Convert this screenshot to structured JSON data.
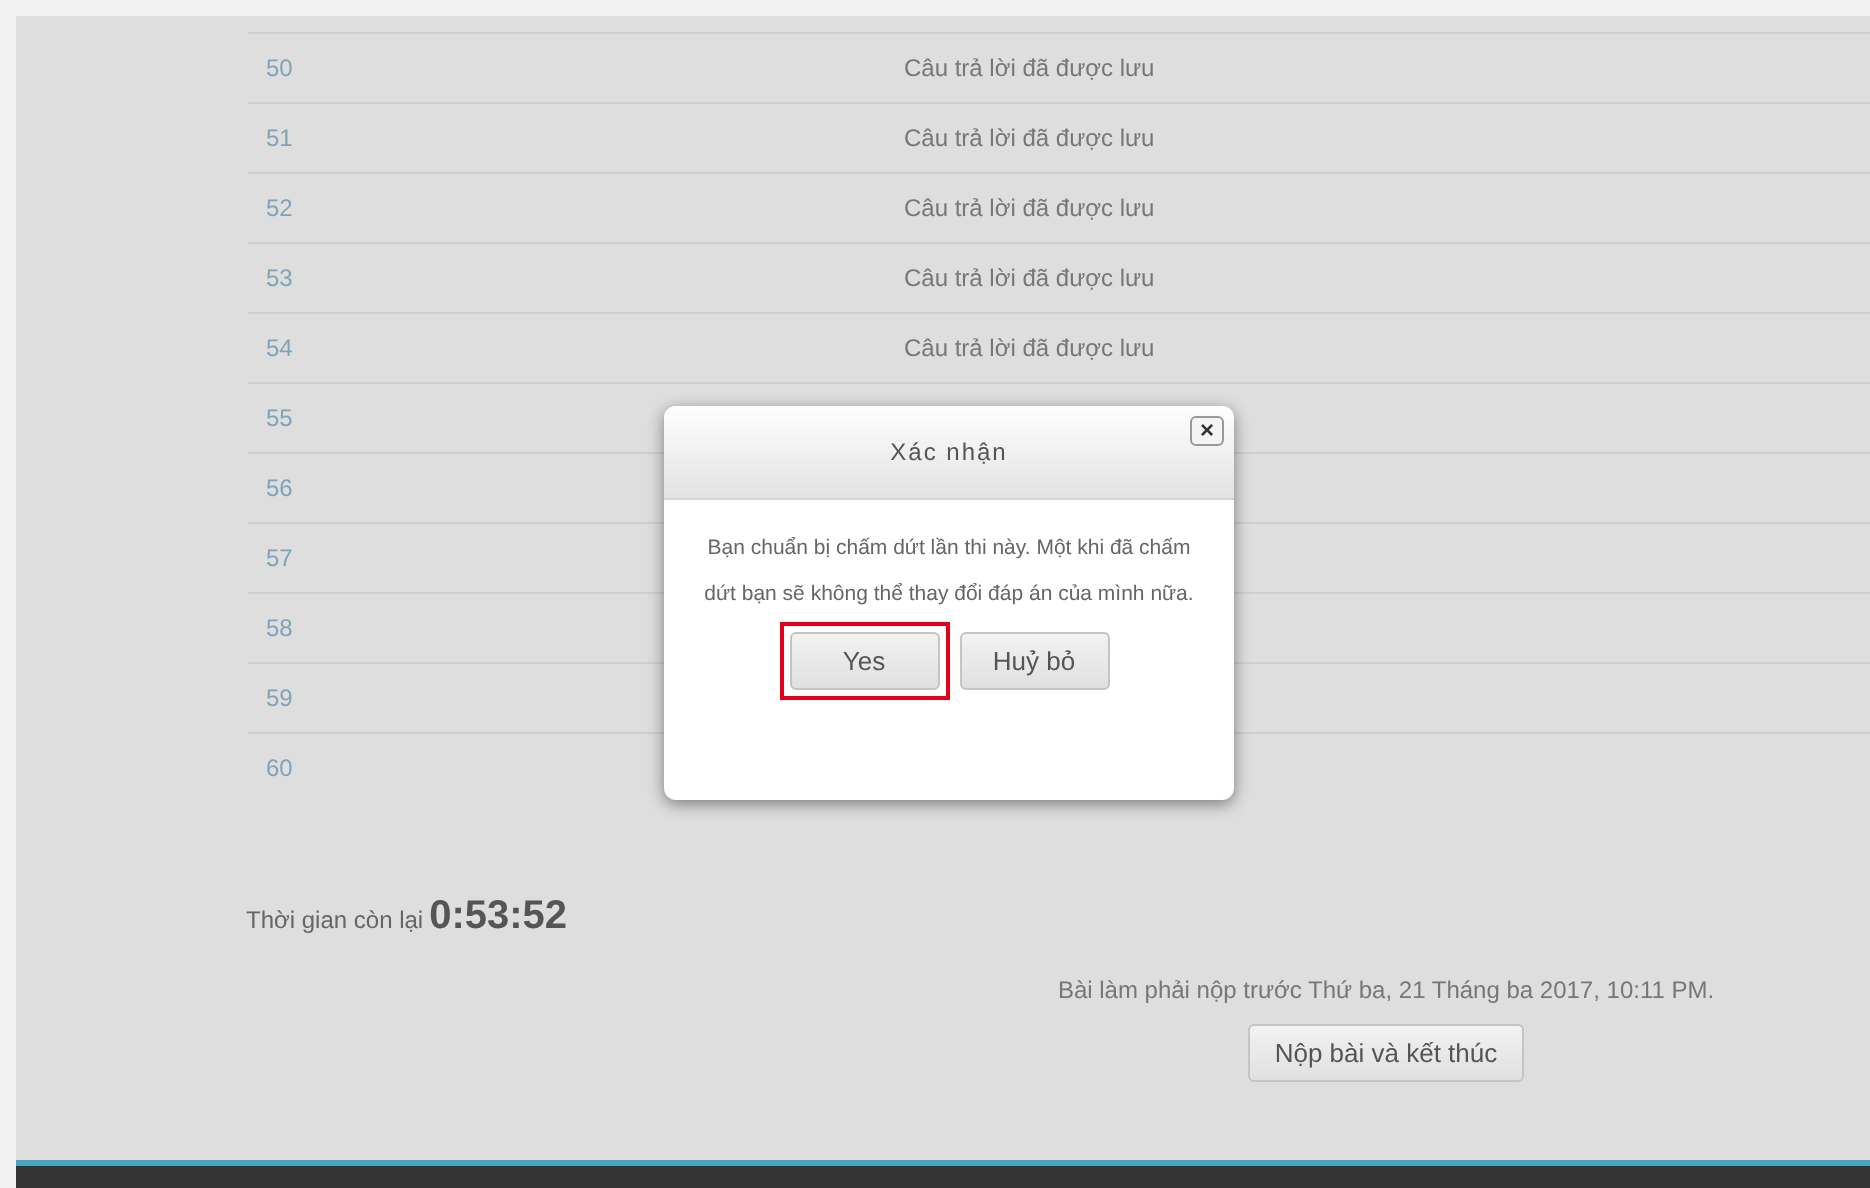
{
  "summary_rows": [
    {
      "question": "50",
      "status": "Câu trả lời đã được lưu"
    },
    {
      "question": "51",
      "status": "Câu trả lời đã được lưu"
    },
    {
      "question": "52",
      "status": "Câu trả lời đã được lưu"
    },
    {
      "question": "53",
      "status": "Câu trả lời đã được lưu"
    },
    {
      "question": "54",
      "status": "Câu trả lời đã được lưu"
    },
    {
      "question": "55"
    },
    {
      "question": "56"
    },
    {
      "question": "57"
    },
    {
      "question": "58"
    },
    {
      "question": "59"
    },
    {
      "question": "60"
    }
  ],
  "timer": {
    "label": "Thời gian còn lại",
    "value": "0:53:52"
  },
  "deadline": "Bài làm phải nộp trước Thứ ba, 21 Tháng ba 2017, 10:11 PM.",
  "submit_button": "Nộp bài và kết thúc",
  "dialog": {
    "title": "Xác nhận",
    "close": "×",
    "message": "Bạn chuẩn bị chấm dứt lần thi này. Một khi đã chấm dứt bạn sẽ không thể thay đổi đáp án của mình nữa.",
    "buttons": [
      {
        "label": "Yes",
        "highlighted": true
      },
      {
        "label": "Huỷ bỏ",
        "highlighted": false
      }
    ]
  }
}
